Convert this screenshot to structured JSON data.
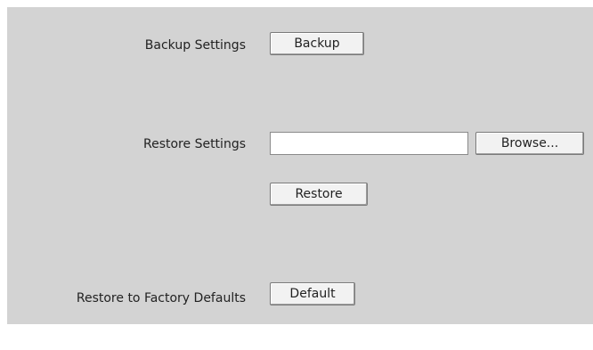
{
  "backup": {
    "label": "Backup Settings",
    "button_label": "Backup"
  },
  "restore": {
    "label": "Restore Settings",
    "file_value": "",
    "browse_label": "Browse...",
    "button_label": "Restore"
  },
  "factory": {
    "label": "Restore to Factory Defaults",
    "button_label": "Default"
  },
  "colors": {
    "panel_background": "#d3d3d3",
    "button_background": "#f2f2f2"
  }
}
